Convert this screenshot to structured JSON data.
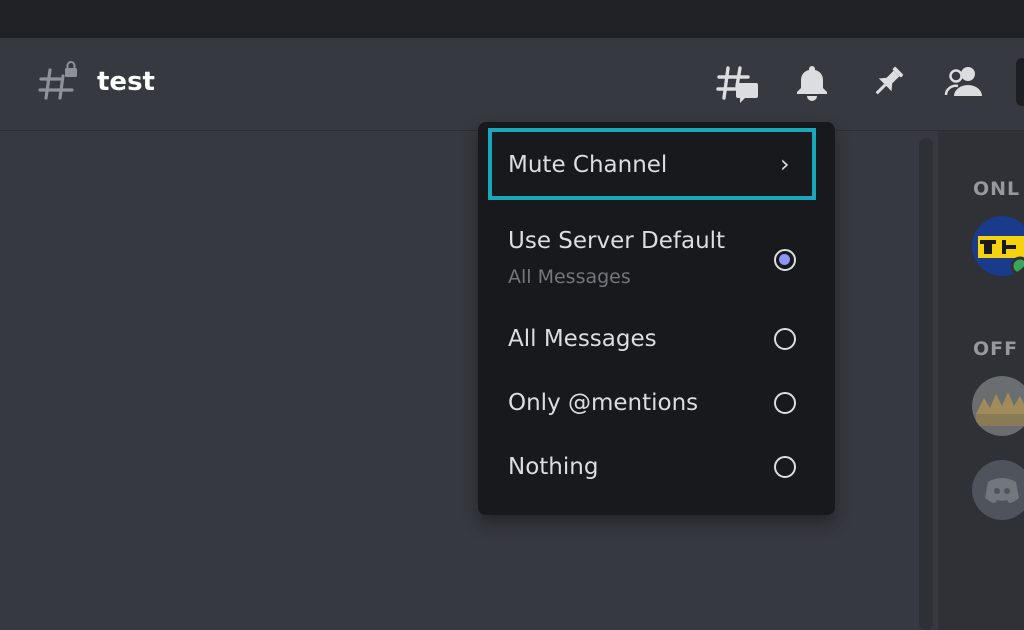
{
  "header": {
    "channel_name": "test",
    "icons": [
      "threads-icon",
      "bell-icon",
      "pin-icon",
      "members-icon"
    ]
  },
  "members": {
    "online_heading": "ONL",
    "offline_heading": "OFF"
  },
  "notification_menu": {
    "mute_label": "Mute Channel",
    "mute_chevron": "›",
    "options": [
      {
        "label": "Use Server Default",
        "sub": "All Messages",
        "selected": true
      },
      {
        "label": "All Messages",
        "selected": false
      },
      {
        "label": "Only @mentions",
        "selected": false
      },
      {
        "label": "Nothing",
        "selected": false
      }
    ]
  },
  "colors": {
    "highlight": "#19a8b9",
    "radio_selected": "#8d96f6",
    "menu_bg": "#18191c",
    "app_bg": "#36393f"
  }
}
